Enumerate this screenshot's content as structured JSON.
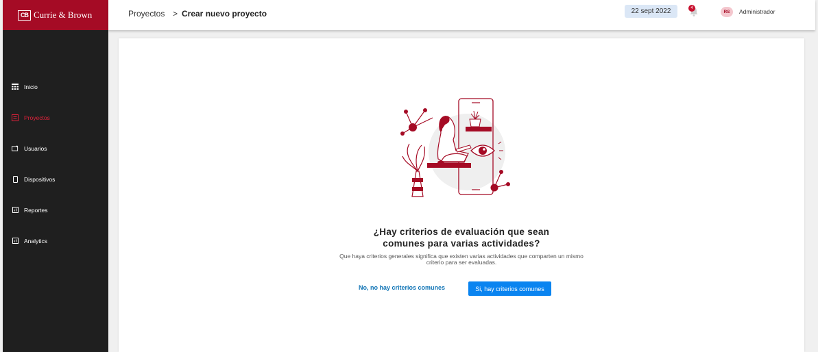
{
  "brand": {
    "logo_mark": "CB",
    "name": "Currie & Brown",
    "color": "#a50b25"
  },
  "sidebar": {
    "items": [
      {
        "label": "Inicio",
        "icon": "grid-icon",
        "active": false
      },
      {
        "label": "Proyectos",
        "icon": "folder-icon",
        "active": true
      },
      {
        "label": "Usuarios",
        "icon": "users-icon",
        "active": false
      },
      {
        "label": "Dispositivos",
        "icon": "device-icon",
        "active": false
      },
      {
        "label": "Reportes",
        "icon": "report-icon",
        "active": false
      },
      {
        "label": "Analytics",
        "icon": "analytics-icon",
        "active": false
      }
    ]
  },
  "header": {
    "breadcrumb_root": "Proyectos",
    "breadcrumb_separator": ">",
    "breadcrumb_current": "Crear nuevo proyecto",
    "date": "22 sept 2022",
    "notification_count": "4",
    "user_initials": "RS",
    "user_name": "Administrador"
  },
  "main": {
    "question_line1": "¿Hay criterios de evaluación que sean",
    "question_line2": "comunes para varias actividades?",
    "description_line1": "Que haya criterios generales significa que existen varias actividades que comparten un mismo",
    "description_line2": "criterio para ser evaluadas.",
    "no_button": "No, no hay criterios comunes",
    "yes_button": "Si, hay criterios comunes"
  },
  "colors": {
    "accent_red": "#a50b25",
    "primary_blue": "#0a84f0",
    "link_blue": "#0e73b5",
    "sidebar_bg": "#1f1f1f"
  }
}
